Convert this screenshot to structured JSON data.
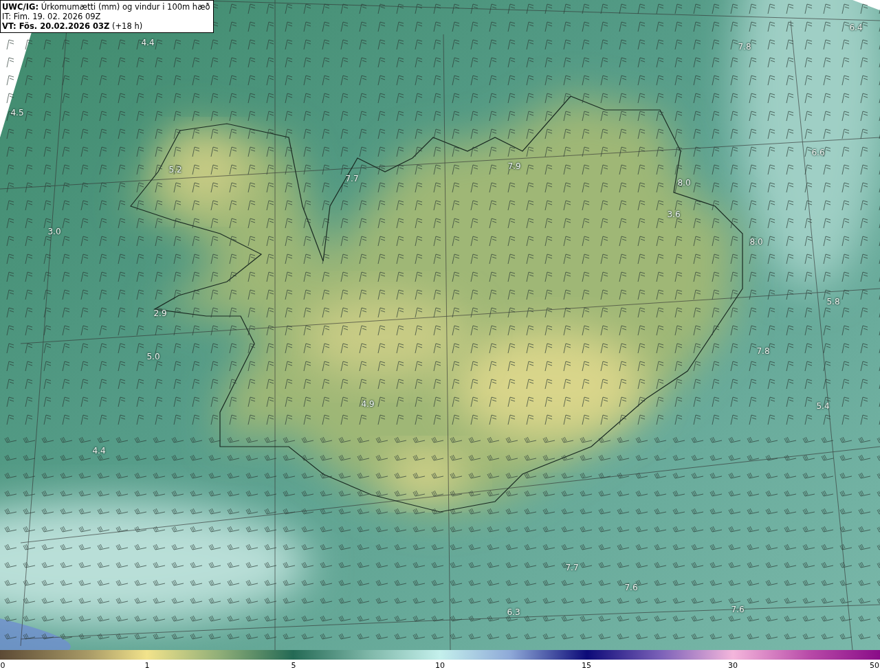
{
  "header": {
    "product": "UWC/IG:",
    "title": "Úrkomumætti (mm) og vindur i 100m hæð",
    "initial_time": "IT: Fim. 19. 02. 2026 09Z",
    "valid_label": "VT: Fös. 20.02.2026 03Z",
    "valid_offset": "(+18 h)"
  },
  "map": {
    "value_labels": [
      "4.4",
      "6.4",
      "7.8",
      "4.5",
      "6.6",
      "7.9",
      "5.2",
      "7.7",
      "8.0",
      "3.6",
      "3.0",
      "8.0",
      "5.8",
      "2.9",
      "5.0",
      "7.8",
      "4.9",
      "5.4",
      "4.4",
      "7.7",
      "7.6",
      "7.6",
      "6.3"
    ]
  },
  "colorbar": {
    "ticks": [
      "0",
      "1",
      "5",
      "10",
      "15",
      "30",
      "50"
    ]
  }
}
